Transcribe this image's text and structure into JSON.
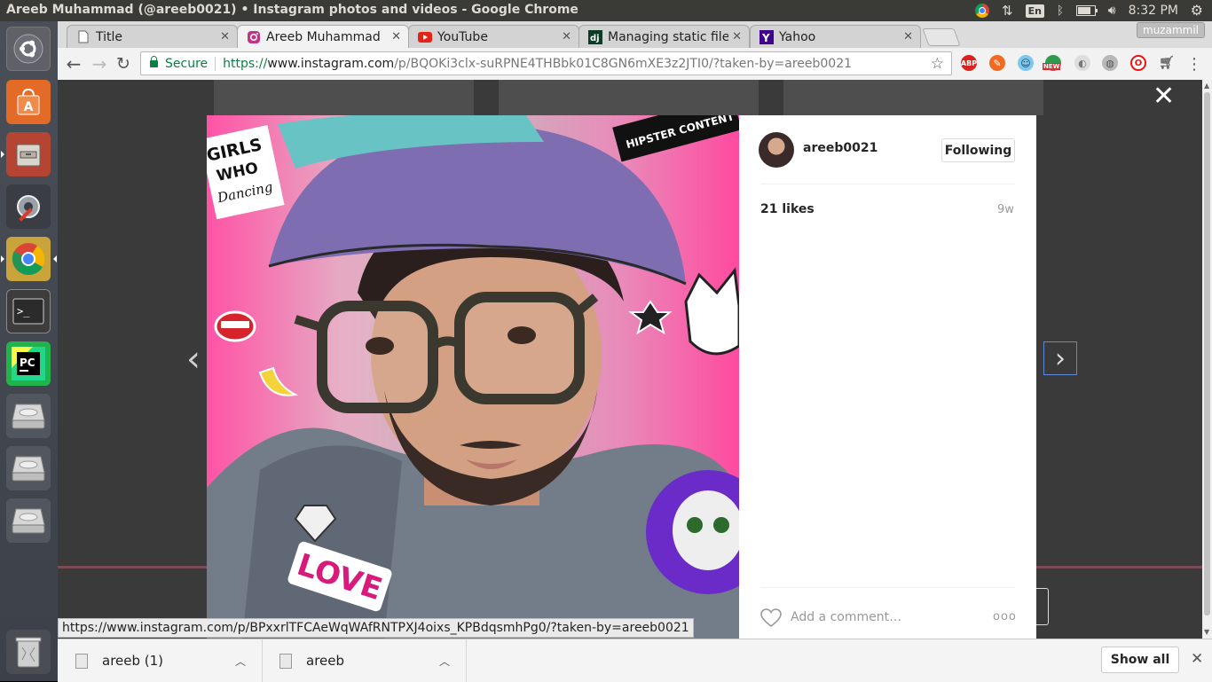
{
  "window_title": "Areeb Muhammad (@areeb0021) • Instagram photos and videos - Google Chrome",
  "tray": {
    "lang": "En",
    "time": "8:32 PM"
  },
  "launcher": [
    "ubuntu-dash",
    "ubuntu-software",
    "file-manager",
    "system-settings",
    "google-chrome",
    "terminal",
    "pycharm",
    "drive-1",
    "drive-2",
    "drive-3",
    "trash"
  ],
  "tabs": [
    {
      "label": "Title",
      "favicon": "page",
      "active": false
    },
    {
      "label": "Areeb Muhammad",
      "favicon": "instagram",
      "active": true
    },
    {
      "label": "YouTube",
      "favicon": "youtube",
      "active": false
    },
    {
      "label": "Managing static file",
      "favicon": "django",
      "active": false
    },
    {
      "label": "Yahoo",
      "favicon": "yahoo",
      "active": false
    }
  ],
  "profile_name": "muzammil",
  "omnibox": {
    "secure_label": "Secure",
    "scheme": "https://",
    "host": "www.instagram.com",
    "path": "/p/BQOKi3clx-suRPNE4THBbk01C8GN6mXE3z2JTI0/?taken-by=areeb0021"
  },
  "extensions": {
    "abp": "ABP",
    "new_badge": "NEW"
  },
  "post": {
    "username": "areeb0021",
    "follow_label": "Following",
    "likes": "21 likes",
    "age": "9w",
    "comment_placeholder": "Add a comment…",
    "more": "ooo"
  },
  "status_bubble": "https://www.instagram.com/p/BPxxrlTFCAeWqWAfRNTPXJ4oixs_KPBdqsmhPg0/?taken-by=areeb0021",
  "downloads": {
    "items": [
      "areeb (1)",
      "areeb"
    ],
    "show_all": "Show all"
  },
  "photo_text": {
    "sticker_girls": "GIRLS",
    "sticker_who": "WHO",
    "sticker_dancing": "Dancing",
    "sticker_hipster": "HIPSTER CONTENT",
    "sticker_love": "LOVE"
  },
  "colors": {
    "accent_blue": "#3897f0",
    "secure_green": "#0b8043"
  }
}
